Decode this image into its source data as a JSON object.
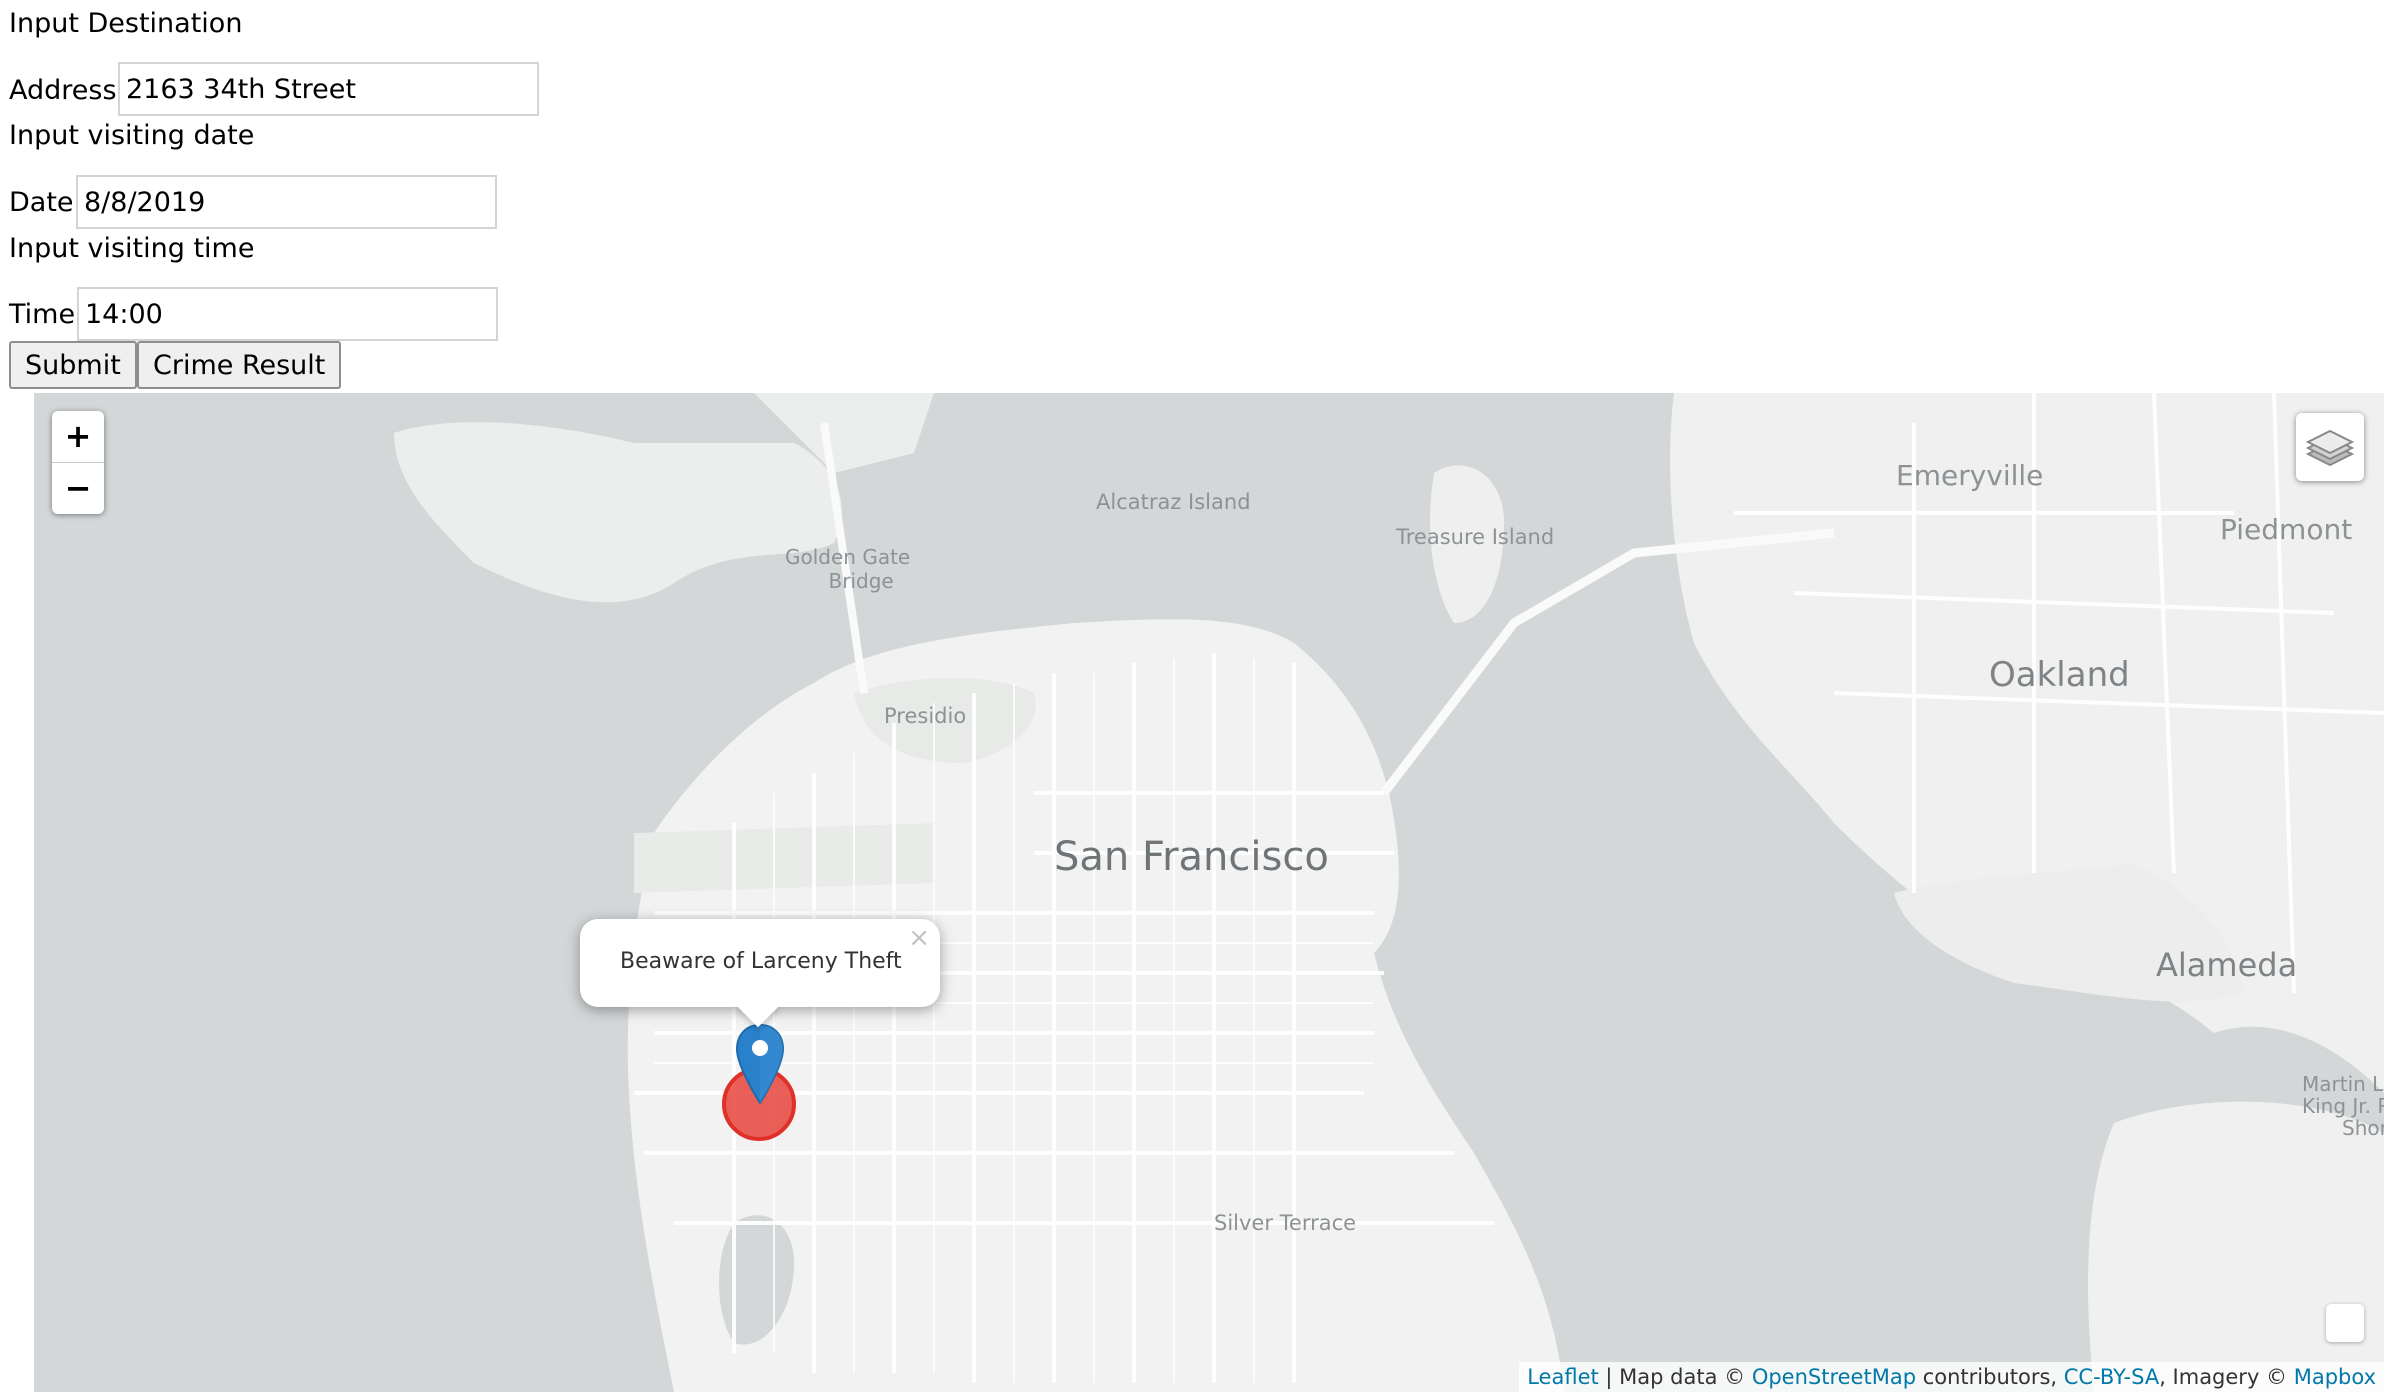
{
  "form": {
    "destination_heading": "Input Destination",
    "address_label": "Address",
    "address_value": "2163 34th Street",
    "date_heading": "Input visiting date",
    "date_label": "Date",
    "date_value": "8/8/2019",
    "time_heading": "Input visiting time",
    "time_label": "Time",
    "time_value": "14:00",
    "submit_label": "Submit",
    "crime_result_label": "Crime Result"
  },
  "map": {
    "zoom_in": "+",
    "zoom_out": "−",
    "places": {
      "alcatraz": "Alcatraz Island",
      "golden_gate_line1": "Golden Gate",
      "golden_gate_line2": "Bridge",
      "treasure_island": "Treasure Island",
      "emeryville": "Emeryville",
      "piedmont": "Piedmont",
      "presidio": "Presidio",
      "oakland": "Oakland",
      "san_francisco": "San Francisco",
      "alameda": "Alameda",
      "silver_terrace": "Silver Terrace",
      "martin_line1": "Martin L",
      "martin_line2": "King Jr. Re",
      "martin_line3": "Shorel"
    },
    "popup": {
      "text": "Beaware of Larceny Theft",
      "close": "×"
    },
    "attribution": {
      "leaflet": "Leaflet",
      "sep1": " | Map data © ",
      "osm": "OpenStreetMap",
      "contributors": " contributors, ",
      "ccbysa": "CC-BY-SA",
      "imagery": ", Imagery © ",
      "mapbox": "Mapbox"
    },
    "colors": {
      "water": "#d3d7d8",
      "land": "#f2f2f2",
      "marker_blue": "#2a81cb",
      "crime_circle": "#e8443b",
      "link": "#0078a8"
    }
  }
}
